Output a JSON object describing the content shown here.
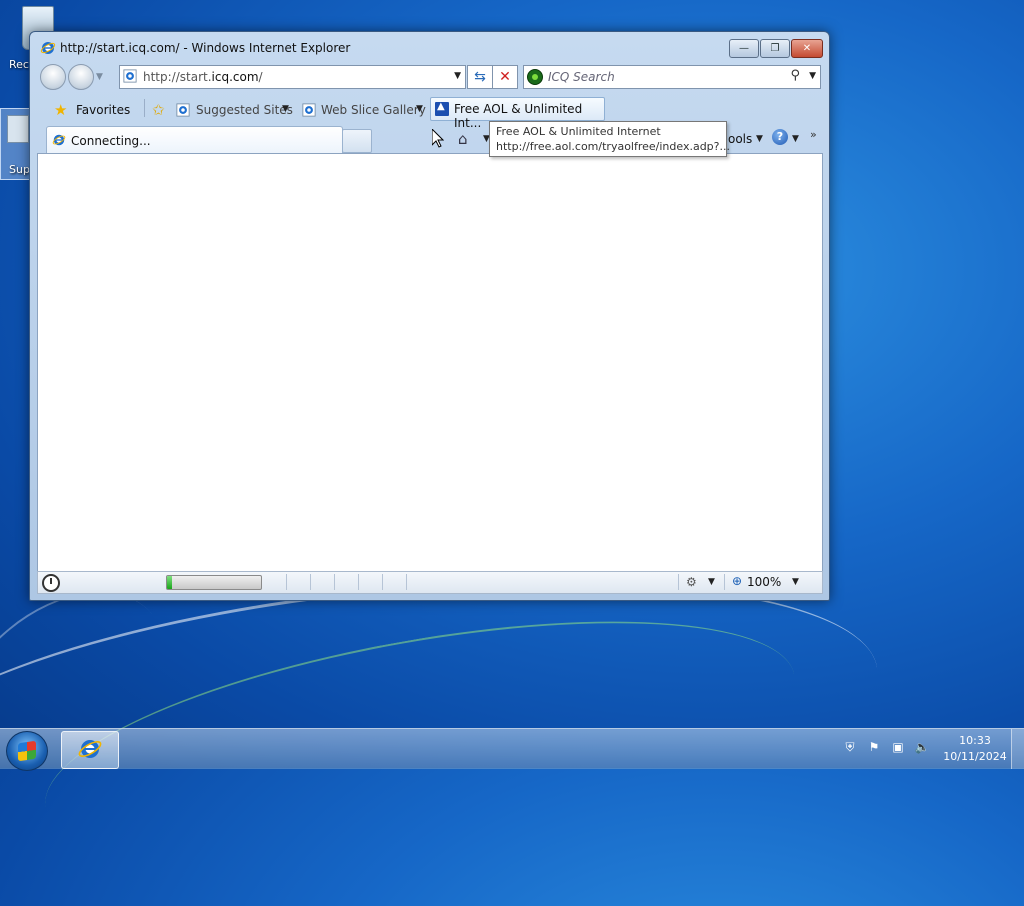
{
  "window": {
    "title": "http://start.icq.com/ - Windows Internet Explorer",
    "minimize_label": "—",
    "restore_label": "❐",
    "close_label": "✕"
  },
  "address": {
    "url_prefix": "http://start.",
    "url_domain": "icq.com",
    "url_suffix": "/",
    "search_placeholder": "ICQ Search"
  },
  "favorites_bar": {
    "favorites_label": "Favorites",
    "items": [
      {
        "label": "Suggested Sites",
        "icon": "ie-page-icon"
      },
      {
        "label": "Web Slice Gallery",
        "icon": "ie-page-icon"
      },
      {
        "label": "Free AOL & Unlimited Int...",
        "icon": "aol-icon"
      }
    ]
  },
  "tabs": [
    {
      "label": "Connecting...",
      "icon": "ie-page-icon"
    }
  ],
  "command_bar": {
    "tools_label": "ools",
    "help_label": "?"
  },
  "tooltip": {
    "line1": "Free AOL & Unlimited Internet",
    "line2": "http://free.aol.com/tryaolfree/index.adp?..."
  },
  "status": {
    "progress_fraction": 0.05,
    "zoom": "100%"
  },
  "desktop": {
    "icons": [
      {
        "label": "Rec"
      },
      {
        "label": "Sup"
      }
    ]
  },
  "taskbar": {
    "time": "10:33",
    "date": "10/11/2024"
  },
  "colors": {
    "desktop_blue": "#1667c7",
    "ie_blue": "#1e6fd0",
    "progress_green": "#1aa51a",
    "close_red": "#c44a31"
  }
}
